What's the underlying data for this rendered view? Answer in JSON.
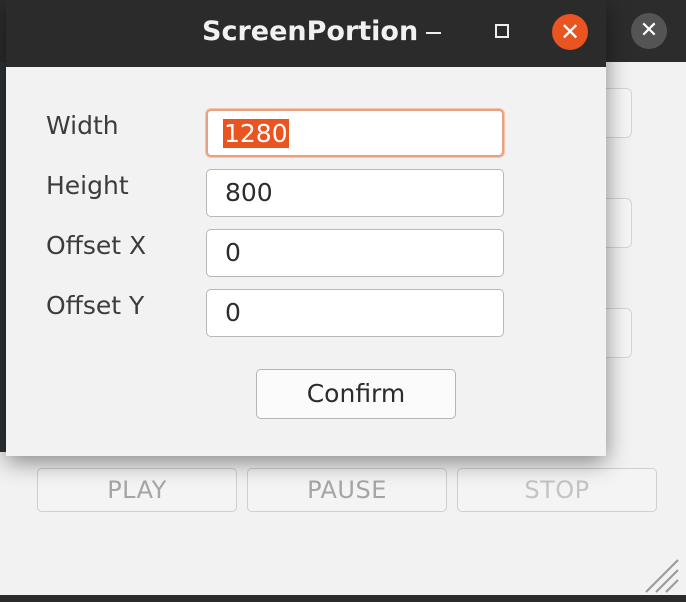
{
  "parent_window": {
    "close_symbol": "✕",
    "buttons": {
      "play": "PLAY",
      "pause": "PAUSE",
      "stop": "STOP"
    }
  },
  "dialog": {
    "title": "ScreenPortion",
    "controls": {
      "minimize": "minimize-icon",
      "maximize": "maximize-icon",
      "close_symbol": "✕"
    },
    "fields": {
      "width": {
        "label": "Width",
        "value": "1280"
      },
      "height": {
        "label": "Height",
        "value": "800"
      },
      "offset_x": {
        "label": "Offset X",
        "value": "0"
      },
      "offset_y": {
        "label": "Offset Y",
        "value": "0"
      }
    },
    "confirm_label": "Confirm"
  },
  "colors": {
    "accent": "#e95420",
    "titlebar": "#2b2b2b",
    "body": "#f2f2f2"
  }
}
